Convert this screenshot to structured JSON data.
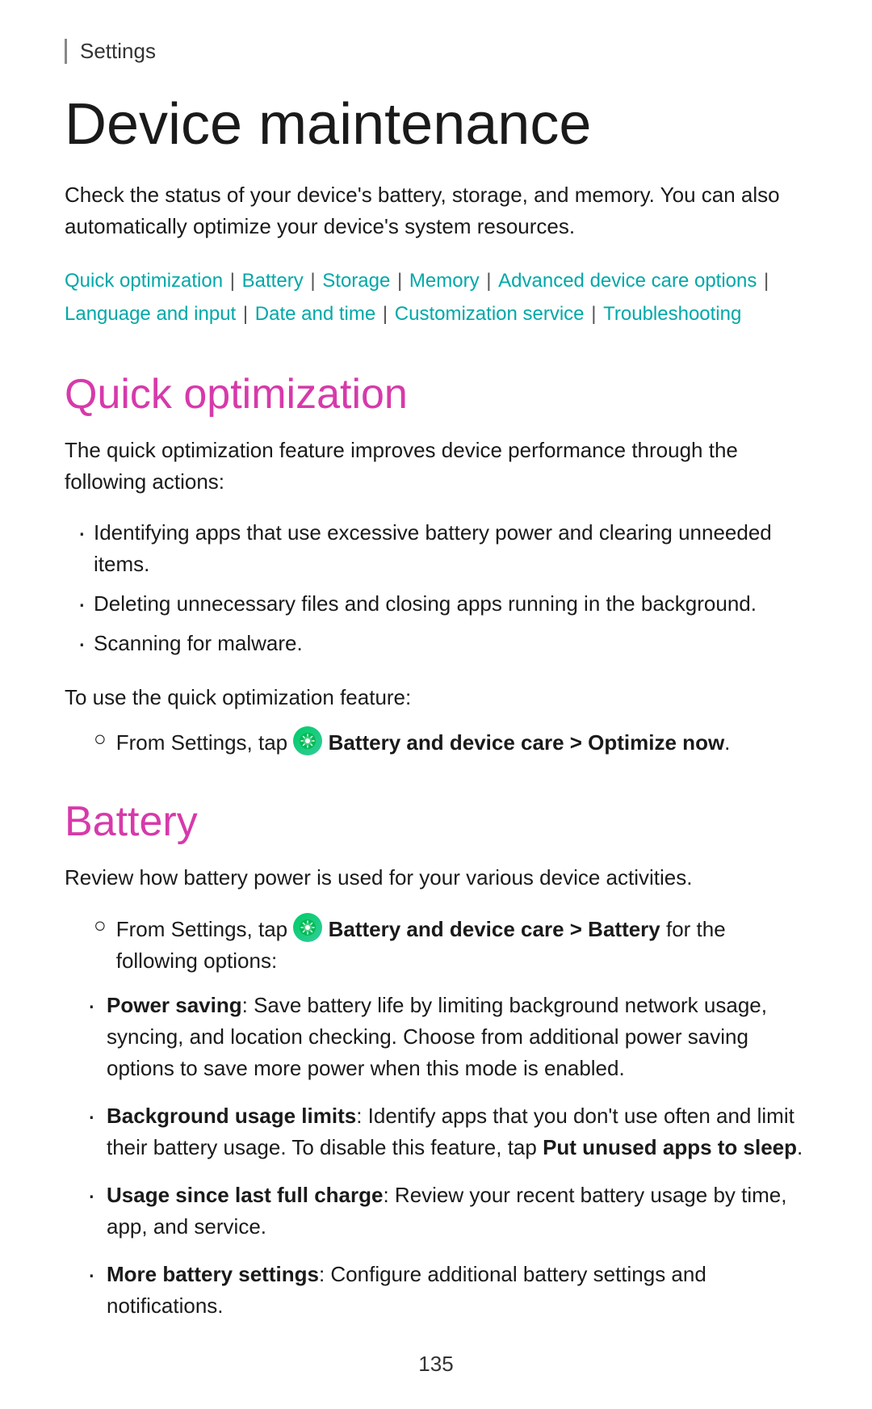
{
  "header": {
    "settings_label": "Settings"
  },
  "page": {
    "title": "Device maintenance",
    "intro": "Check the status of your device's battery, storage, and memory. You can also automatically optimize your device's system resources.",
    "nav_links": [
      {
        "label": "Quick optimization",
        "separator": true
      },
      {
        "label": "Battery",
        "separator": true
      },
      {
        "label": "Storage",
        "separator": true
      },
      {
        "label": "Memory",
        "separator": true
      },
      {
        "label": "Advanced device care options",
        "separator": true
      },
      {
        "label": "Language and input",
        "separator": true
      },
      {
        "label": "Date and time",
        "separator": true
      },
      {
        "label": "Customization service",
        "separator": true
      },
      {
        "label": "Troubleshooting",
        "separator": false
      }
    ]
  },
  "quick_optimization": {
    "title": "Quick optimization",
    "desc": "The quick optimization feature improves device performance through the following actions:",
    "bullets": [
      "Identifying apps that use excessive battery power and clearing unneeded items.",
      "Deleting unnecessary files and closing apps running in the background.",
      "Scanning for malware."
    ],
    "use_text": "To use the quick optimization feature:",
    "step": "From Settings, tap",
    "step_bold": "Battery and device care > Optimize now",
    "step_end": "."
  },
  "battery": {
    "title": "Battery",
    "desc": "Review how battery power is used for your various device activities.",
    "step": "From Settings, tap",
    "step_bold": "Battery and device care > Battery",
    "step_end": "for the following options:",
    "options": [
      {
        "bold": "Power saving",
        "text": ": Save battery life by limiting background network usage, syncing, and location checking. Choose from additional power saving options to save more power when this mode is enabled."
      },
      {
        "bold": "Background usage limits",
        "text": ": Identify apps that you don't use often and limit their battery usage. To disable this feature, tap",
        "inline_bold": "Put unused apps to sleep",
        "text_end": "."
      },
      {
        "bold": "Usage since last full charge",
        "text": ": Review your recent battery usage by time, app, and service."
      },
      {
        "bold": "More battery settings",
        "text": ": Configure additional battery settings and notifications."
      }
    ]
  },
  "page_number": "135"
}
